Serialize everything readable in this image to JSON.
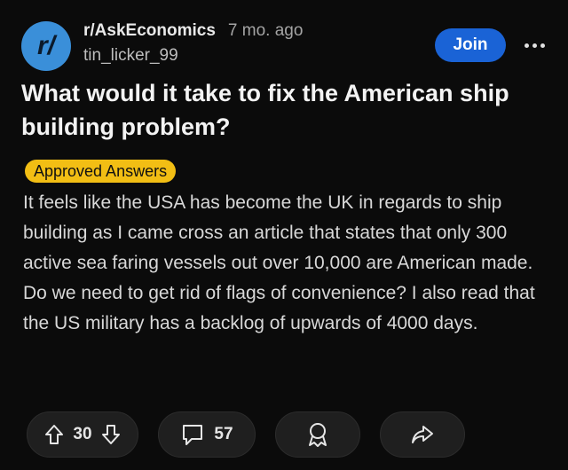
{
  "post": {
    "avatar_text": "r/",
    "subreddit": "r/AskEconomics",
    "age": "7 mo. ago",
    "author": "tin_licker_99",
    "join_label": "Join",
    "title": "What would it take to fix the American ship building problem?",
    "flair": "Approved Answers",
    "body": "It feels like the USA has become the UK in regards to ship building as I came cross an article that states that only 300 active sea faring vessels out over 10,000 are American made. Do we need to get rid of flags of convenience? I also read that the US military has a backlog of upwards of 4000 days."
  },
  "actions": {
    "score": "30",
    "comments": "57"
  },
  "colors": {
    "background": "#0b0b0b",
    "join_button": "#1a63d6",
    "flair": "#f2be14",
    "avatar": "#3a8fd9"
  },
  "icons": [
    "upvote-icon",
    "downvote-icon",
    "comment-icon",
    "award-icon",
    "share-icon",
    "more-icon"
  ]
}
